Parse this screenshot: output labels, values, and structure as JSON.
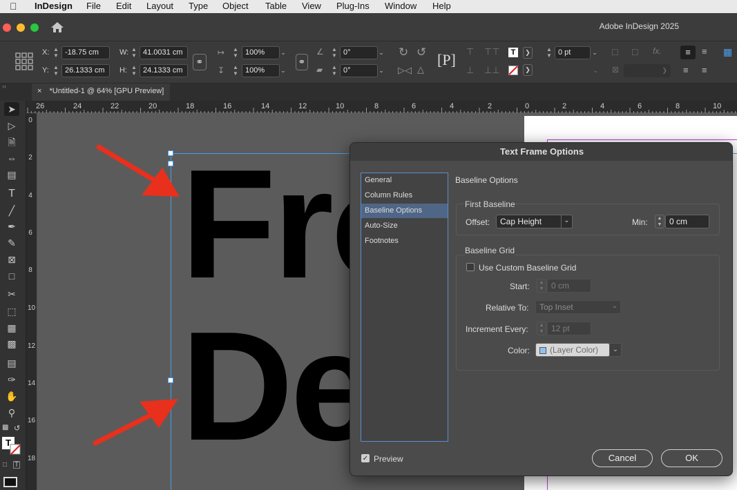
{
  "menubar": {
    "apple": "",
    "app_name": "InDesign",
    "items": [
      "File",
      "Edit",
      "Layout",
      "Type",
      "Object",
      "Table",
      "View",
      "Plug-Ins",
      "Window",
      "Help"
    ]
  },
  "window": {
    "title": "Adobe InDesign 2025",
    "home_icon": "home-icon"
  },
  "control": {
    "x_label": "X:",
    "x_value": "-18.75 cm",
    "y_label": "Y:",
    "y_value": "26.1333 cm",
    "w_label": "W:",
    "w_value": "41.0031 cm",
    "h_label": "H:",
    "h_value": "24.1333 cm",
    "scale_x": "100%",
    "scale_y": "100%",
    "rotate": "0°",
    "shear": "0°",
    "stroke_weight": "0 pt"
  },
  "tab": {
    "close": "×",
    "label": "*Untitled-1 @ 64% [GPU Preview]"
  },
  "hruler": {
    "ticks": [
      "26",
      "24",
      "22",
      "20",
      "18",
      "16",
      "14",
      "12",
      "10",
      "8",
      "6",
      "4",
      "2",
      "0",
      "2",
      "4",
      "6",
      "8",
      "10"
    ]
  },
  "vruler": {
    "ticks": [
      "0",
      "2",
      "4",
      "6",
      "8",
      "10",
      "12",
      "14",
      "16",
      "18"
    ]
  },
  "document": {
    "line1": "Fro",
    "line2": "De"
  },
  "dialog": {
    "title": "Text Frame Options",
    "categories": [
      "General",
      "Column Rules",
      "Baseline Options",
      "Auto-Size",
      "Footnotes"
    ],
    "selected_category": "Baseline Options",
    "section_title": "Baseline Options",
    "first_baseline": {
      "title": "First Baseline",
      "offset_label": "Offset:",
      "offset_value": "Cap Height",
      "min_label": "Min:",
      "min_value": "0 cm"
    },
    "baseline_grid": {
      "title": "Baseline Grid",
      "use_custom_label": "Use Custom Baseline Grid",
      "use_custom_checked": false,
      "start_label": "Start:",
      "start_value": "0 cm",
      "relative_label": "Relative To:",
      "relative_value": "Top Inset",
      "increment_label": "Increment Every:",
      "increment_value": "12 pt",
      "color_label": "Color:",
      "color_value": "(Layer Color)",
      "swatch_color": "#8fc3f2"
    },
    "preview_label": "Preview",
    "preview_checked": true,
    "cancel_label": "Cancel",
    "ok_label": "OK"
  },
  "colors": {
    "annotation_arrow": "#e8301c",
    "selection": "#4a9ee8",
    "accent_selected": "#4f6686"
  }
}
